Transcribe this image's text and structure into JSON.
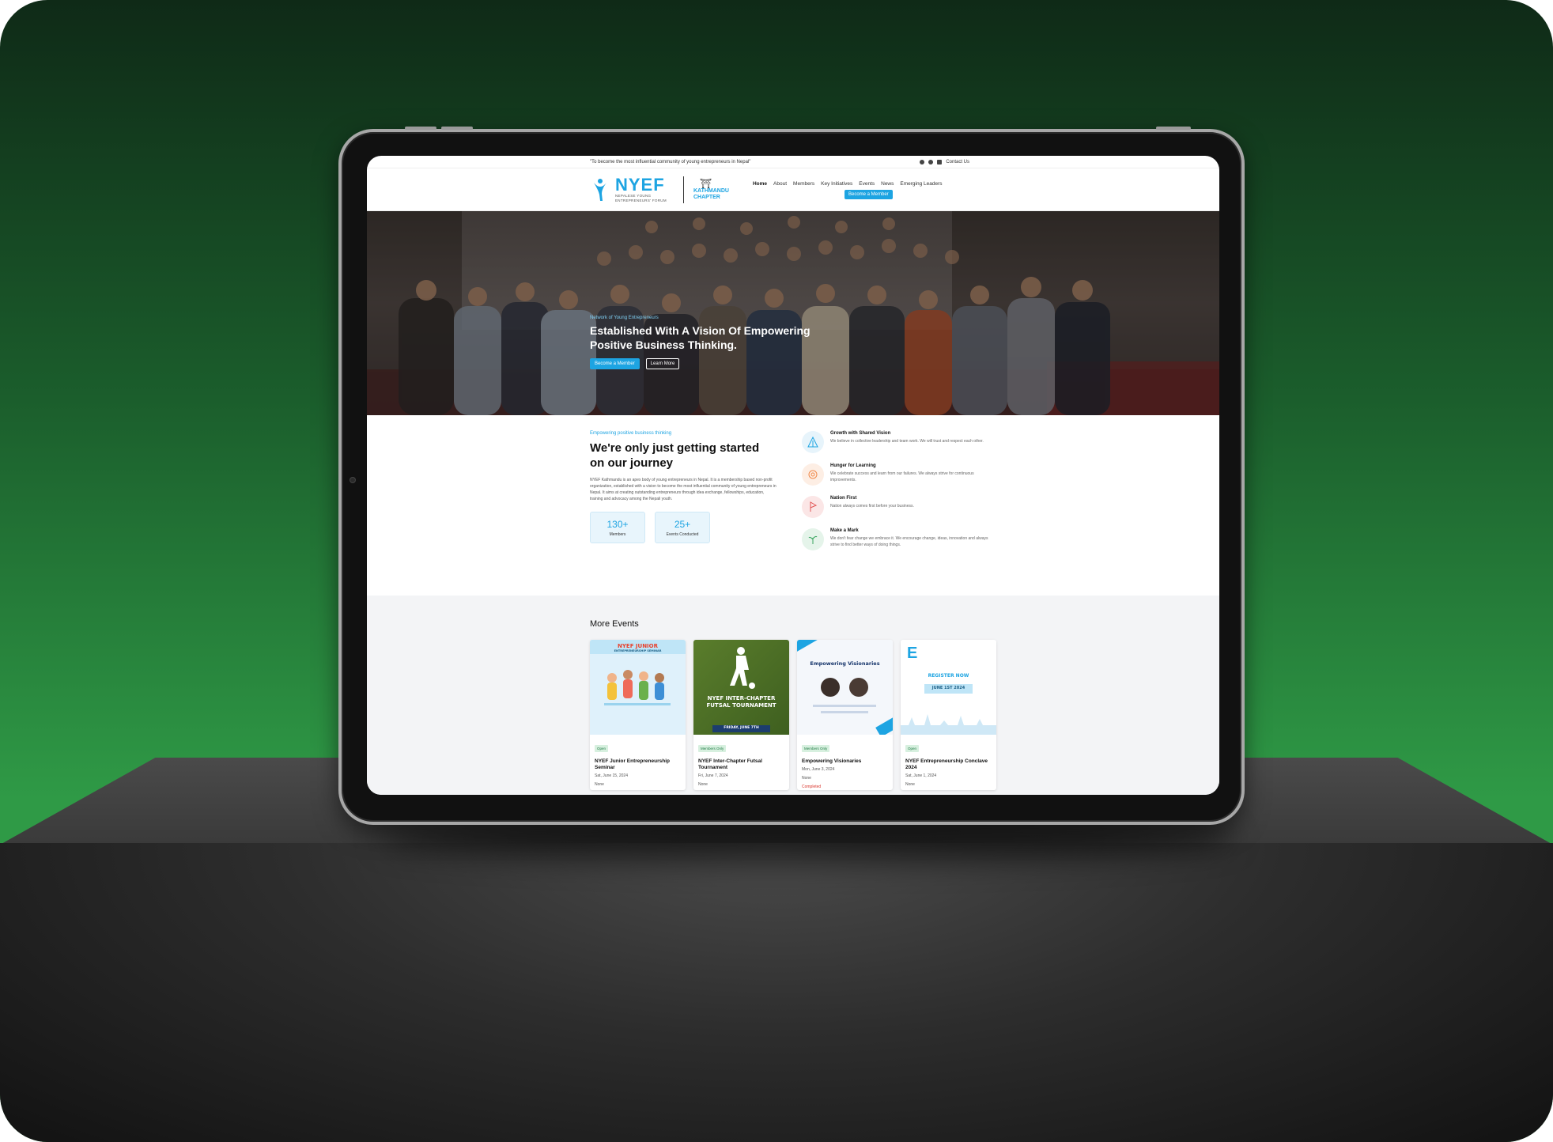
{
  "topbar": {
    "tagline": "\"To become the most influential community of young entrepreneurs in Nepal\"",
    "contact_label": "Contact Us",
    "social_icons": [
      "instagram-icon",
      "facebook-icon",
      "linkedin-icon"
    ]
  },
  "brand": {
    "name": "NYEF",
    "subtitle": "NEPALESE YOUNG ENTREPRENEURS' FORUM",
    "chapter_line1": "KATHMANDU",
    "chapter_line2": "CHAPTER",
    "accent": "#1da4e2"
  },
  "nav": {
    "links": [
      "Home",
      "About",
      "Members",
      "Key Initiatives",
      "Events",
      "News",
      "Emerging Leaders"
    ],
    "active": "Home",
    "cta": "Become a Member"
  },
  "hero": {
    "eyebrow": "Network of Young Entrepreneurs",
    "title": "Established With A Vision Of Empowering Positive Business Thinking.",
    "primary_cta": "Become a Member",
    "secondary_cta": "Learn More"
  },
  "about": {
    "eyebrow": "Empowering positive business thinking",
    "title": "We're only just getting started on our journey",
    "body": "NYEF Kathmandu is an apex body of young entrepreneurs in Nepal. It is a membership based non-profit organization, established with a vision to become the most influential community of young entrepreneurs in Nepal. It aims at creating outstanding entrepreneurs through idea exchange, fellowships, education, training and advocacy among the Nepali youth.",
    "stats": [
      {
        "value": "130+",
        "label": "Members"
      },
      {
        "value": "25+",
        "label": "Events Conducted"
      }
    ],
    "values": [
      {
        "title": "Growth with Shared Vision",
        "text": "We believe in collective leadership and team work. We will trust and respect each other.",
        "icon": "growth-icon",
        "color": "#1da4e2"
      },
      {
        "title": "Hunger for Learning",
        "text": "We celebrate success and learn from our failures. We always strive for continuous improvements.",
        "icon": "learning-icon",
        "color": "#f08a4b"
      },
      {
        "title": "Nation First",
        "text": "Nation always comes first before your business.",
        "icon": "nation-icon",
        "color": "#e25555"
      },
      {
        "title": "Make a Mark",
        "text": "We don't fear change we embrace it. We encourage change, ideas, innovation and always strive to find better ways of doing things.",
        "icon": "mark-icon",
        "color": "#3aa660"
      }
    ]
  },
  "events": {
    "title": "More Events",
    "cards": [
      {
        "tag": "Open",
        "title": "NYEF Junior Entrepreneurship Seminar",
        "date": "Sat, June 15, 2024",
        "price": "None",
        "status": "",
        "poster_title": "NYEF JUNIOR",
        "poster_sub": "ENTREPRENEURSHIP SEMINAR"
      },
      {
        "tag": "Members Only",
        "title": "NYEF Inter-Chapter Futsal Tournament",
        "date": "Fri, June 7, 2024",
        "price": "None",
        "status": "",
        "poster_title": "NYEF INTER-CHAPTER FUTSAL TOURNAMENT",
        "poster_sub": "FRIDAY, JUNE 7TH"
      },
      {
        "tag": "Members Only",
        "title": "Empowering Visionaries",
        "date": "Mon, June 3, 2024",
        "price": "None",
        "status": "Completed",
        "poster_title": "Empowering Visionaries",
        "poster_sub": ""
      },
      {
        "tag": "Open",
        "title": "NYEF Entrepreneurship Conclave 2024",
        "date": "Sat, June 1, 2024",
        "price": "None",
        "status": "",
        "poster_title": "REGISTER NOW",
        "poster_sub": "JUNE 1ST 2024"
      }
    ]
  }
}
